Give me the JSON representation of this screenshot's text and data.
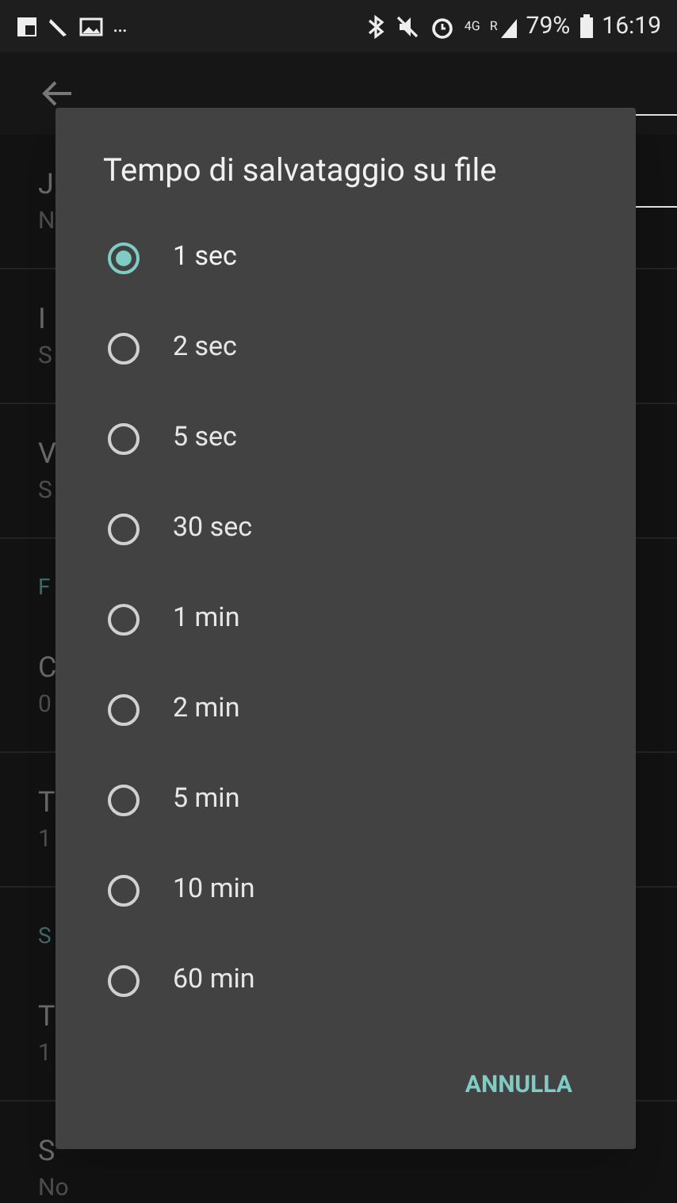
{
  "status_bar": {
    "overflow": "…",
    "network": "4G",
    "roaming": "R",
    "battery": "79%",
    "time": "16:19"
  },
  "background_items": [
    {
      "kind": "setting",
      "title": "J",
      "subtitle": "N"
    },
    {
      "kind": "setting",
      "title": "I",
      "subtitle": "S"
    },
    {
      "kind": "setting",
      "title": "V",
      "subtitle": "S"
    },
    {
      "kind": "header",
      "title": "F"
    },
    {
      "kind": "setting",
      "title": "C",
      "subtitle": "0"
    },
    {
      "kind": "setting",
      "title": "T",
      "subtitle": "1"
    },
    {
      "kind": "header",
      "title": "S"
    },
    {
      "kind": "setting",
      "title": "T",
      "subtitle": "1"
    },
    {
      "kind": "setting",
      "title": "S",
      "subtitle": "No"
    }
  ],
  "dialog": {
    "title": "Tempo di salvataggio su file",
    "options": [
      {
        "label": "1 sec",
        "selected": true
      },
      {
        "label": "2 sec",
        "selected": false
      },
      {
        "label": "5 sec",
        "selected": false
      },
      {
        "label": "30 sec",
        "selected": false
      },
      {
        "label": "1 min",
        "selected": false
      },
      {
        "label": "2 min",
        "selected": false
      },
      {
        "label": "5 min",
        "selected": false
      },
      {
        "label": "10 min",
        "selected": false
      },
      {
        "label": "60 min",
        "selected": false
      }
    ],
    "cancel": "ANNULLA"
  }
}
